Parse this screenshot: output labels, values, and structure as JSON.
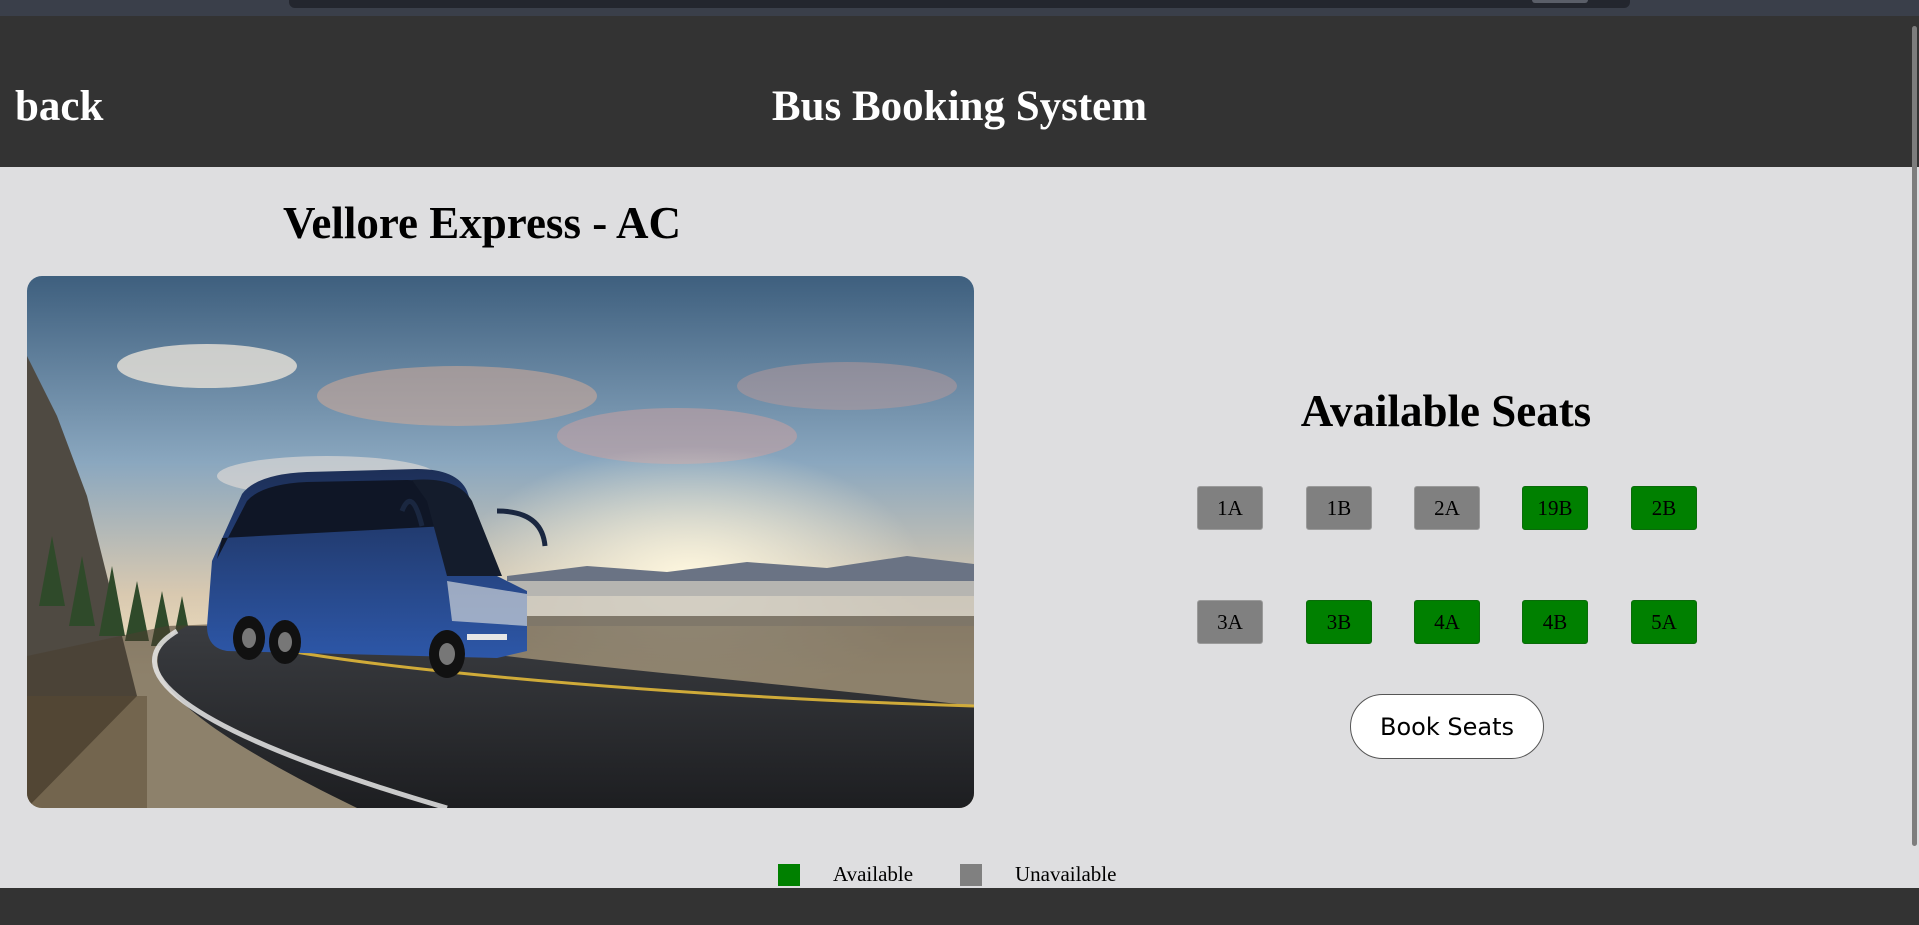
{
  "header": {
    "back_label": "back",
    "title": "Bus Booking System"
  },
  "bus": {
    "name": "Vellore Express - AC"
  },
  "seats_section": {
    "title": "Available Seats",
    "rows": [
      [
        {
          "label": "1A",
          "status": "unavailable"
        },
        {
          "label": "1B",
          "status": "unavailable"
        },
        {
          "label": "2A",
          "status": "unavailable"
        },
        {
          "label": "19B",
          "status": "available"
        },
        {
          "label": "2B",
          "status": "available"
        }
      ],
      [
        {
          "label": "3A",
          "status": "unavailable"
        },
        {
          "label": "3B",
          "status": "available"
        },
        {
          "label": "4A",
          "status": "available"
        },
        {
          "label": "4B",
          "status": "available"
        },
        {
          "label": "5A",
          "status": "available"
        }
      ]
    ],
    "book_button_label": "Book Seats"
  },
  "legend": {
    "available_label": "Available",
    "unavailable_label": "Unavailable"
  },
  "colors": {
    "available": "#008000",
    "unavailable": "#808080",
    "header_bg": "#333333",
    "page_bg": "#dedee0"
  }
}
